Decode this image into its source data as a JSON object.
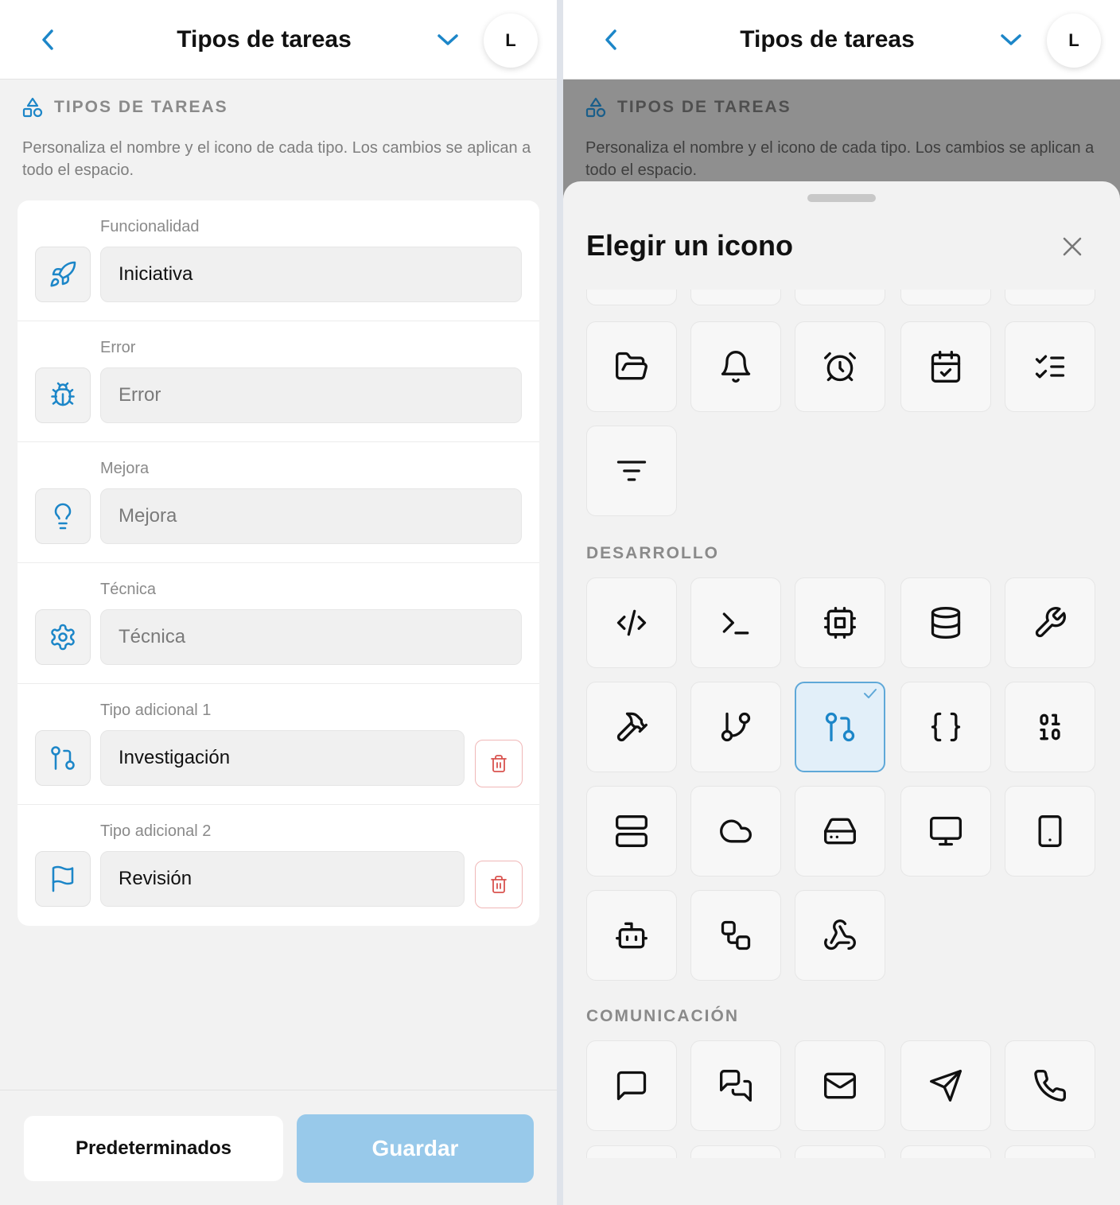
{
  "left": {
    "header": {
      "title": "Tipos de tareas",
      "avatar_initial": "L"
    },
    "section": {
      "title": "TIPOS DE TAREAS",
      "description": "Personaliza el nombre y el icono de cada tipo. Los cambios se aplican a todo el espacio."
    },
    "types": [
      {
        "label": "Funcionalidad",
        "value": "Iniciativa",
        "icon": "rocket-icon"
      },
      {
        "label": "Error",
        "value": "Error",
        "icon": "bug-icon"
      },
      {
        "label": "Mejora",
        "value": "Mejora",
        "icon": "lightbulb-icon"
      },
      {
        "label": "Técnica",
        "value": "Técnica",
        "icon": "gear-icon"
      },
      {
        "label": "Tipo adicional 1",
        "value": "Investigación",
        "icon": "git-compare-icon",
        "deletable": true
      },
      {
        "label": "Tipo adicional 2",
        "value": "Revisión",
        "icon": "flag-icon",
        "deletable": true
      }
    ],
    "footer": {
      "defaults_label": "Predeterminados",
      "save_label": "Guardar"
    }
  },
  "right": {
    "header": {
      "title": "Tipos de tareas",
      "avatar_initial": "L"
    },
    "section": {
      "title": "TIPOS DE TAREAS",
      "description": "Personaliza el nombre y el icono de cada tipo. Los cambios se aplican a todo el espacio."
    },
    "sheet": {
      "title": "Elegir un icono",
      "general_icons": [
        "folder-open-icon",
        "bell-icon",
        "alarm-clock-icon",
        "calendar-check-icon",
        "list-checks-icon",
        "filter-lines-icon"
      ],
      "dev_label": "DESARROLLO",
      "dev_icons": [
        "code-icon",
        "terminal-icon",
        "cpu-icon",
        "database-icon",
        "wrench-icon",
        "hammer-icon",
        "git-branch-icon",
        "git-compare-icon",
        "braces-icon",
        "binary-icon",
        "server-icon",
        "cloud-icon",
        "hard-drive-icon",
        "monitor-icon",
        "tablet-icon",
        "bot-icon",
        "workflow-icon",
        "webhook-icon"
      ],
      "selected_icon": "git-compare-icon",
      "comm_label": "COMUNICACIÓN",
      "comm_icons": [
        "message-square-icon",
        "messages-icon",
        "mail-icon",
        "send-icon",
        "phone-icon"
      ]
    }
  },
  "colors": {
    "accent": "#1c86c8",
    "danger": "#d9534f",
    "save_disabled": "#98c9ea"
  }
}
